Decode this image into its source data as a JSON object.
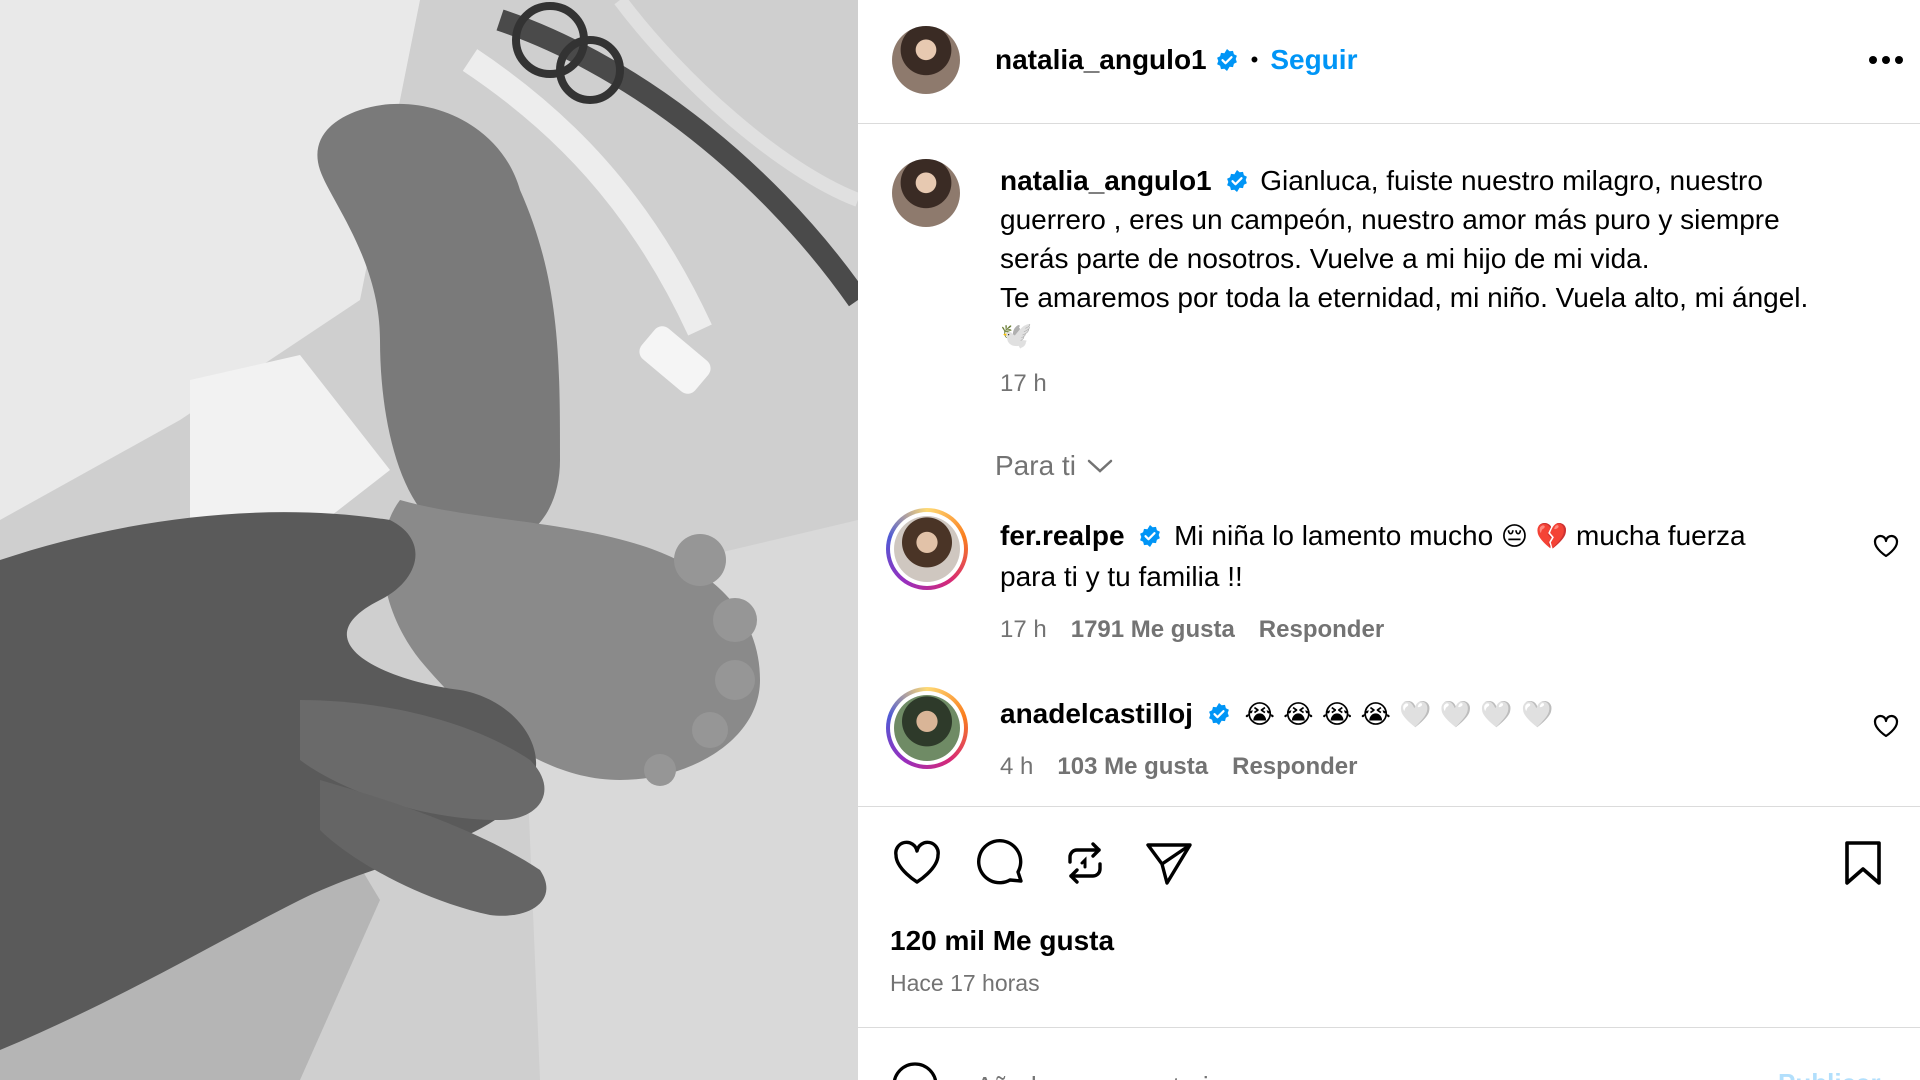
{
  "post_author": {
    "username": "natalia_angulo1",
    "follow_label": "Seguir",
    "separator": "•"
  },
  "caption": {
    "username": "natalia_angulo1",
    "line1": "Gianluca, fuiste nuestro milagro, nuestro",
    "line2": "guerrero , eres un campeón, nuestro amor más puro y siempre",
    "line3": "serás parte de nosotros. Vuelve a mi hijo de mi vida.",
    "line4": "Te amaremos por toda la eternidad, mi niño. Vuela alto, mi ángel.",
    "emoji": "🕊️",
    "time": "17 h"
  },
  "sort": {
    "label": "Para ti"
  },
  "comments": [
    {
      "username": "fer.realpe",
      "text_part1": "Mi niña lo lamento mucho",
      "emoji1": "😔",
      "emoji2": "💔",
      "text_part2": "mucha fuerza",
      "line2": "para ti y tu familia !!",
      "time": "17 h",
      "likes": "1791 Me gusta",
      "reply": "Responder"
    },
    {
      "username": "anadelcastilloj",
      "emojis": "😭 😭 😭 😭 🤍 🤍 🤍 🤍",
      "time": "4 h",
      "likes": "103 Me gusta",
      "reply": "Responder"
    }
  ],
  "actions": {
    "likes_count": "120 mil Me gusta",
    "posted": "Hace 17 horas"
  },
  "comment_box": {
    "placeholder": "Añade un comentario...",
    "post_label": "Publicar"
  },
  "colors": {
    "accent": "#0095f6",
    "verified": "#0095f6",
    "muted": "#737373",
    "divider": "#dbdbdb"
  }
}
